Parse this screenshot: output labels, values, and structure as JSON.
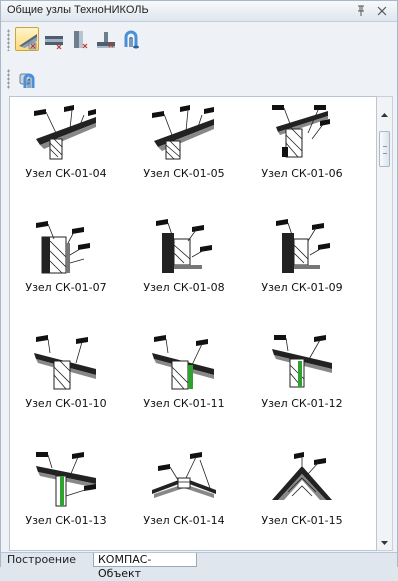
{
  "panel": {
    "title": "Общие узлы ТехноНИКОЛЬ",
    "pin_icon": "pin-icon",
    "close_icon": "close-icon"
  },
  "toolbar_top": {
    "tools": [
      {
        "name": "roof-node-icon",
        "active": true
      },
      {
        "name": "wall-node-icon",
        "active": false
      },
      {
        "name": "column-node-icon",
        "active": false
      },
      {
        "name": "foundation-node-icon",
        "active": false
      },
      {
        "name": "pipe-node-icon",
        "active": false
      }
    ]
  },
  "toolbar_second": {
    "tools": [
      {
        "name": "pipe-node-icon",
        "active": false
      }
    ]
  },
  "items": [
    {
      "label": "Узел СК-01-04",
      "thumb": "node-04"
    },
    {
      "label": "Узел СК-01-05",
      "thumb": "node-05"
    },
    {
      "label": "Узел СК-01-06",
      "thumb": "node-06"
    },
    {
      "label": "Узел СК-01-07",
      "thumb": "node-07"
    },
    {
      "label": "Узел СК-01-08",
      "thumb": "node-08"
    },
    {
      "label": "Узел СК-01-09",
      "thumb": "node-09"
    },
    {
      "label": "Узел СК-01-10",
      "thumb": "node-10"
    },
    {
      "label": "Узел СК-01-11",
      "thumb": "node-11"
    },
    {
      "label": "Узел СК-01-12",
      "thumb": "node-12"
    },
    {
      "label": "Узел СК-01-13",
      "thumb": "node-13"
    },
    {
      "label": "Узел СК-01-14",
      "thumb": "node-14"
    },
    {
      "label": "Узел СК-01-15",
      "thumb": "node-15"
    }
  ],
  "tabs": [
    {
      "label": "Построение",
      "active": false
    },
    {
      "label": "КОМПАС-Объект",
      "active": true
    }
  ],
  "colors": {
    "accent_green": "#2fa12f",
    "active_tool_bg": "#ffd97a"
  }
}
